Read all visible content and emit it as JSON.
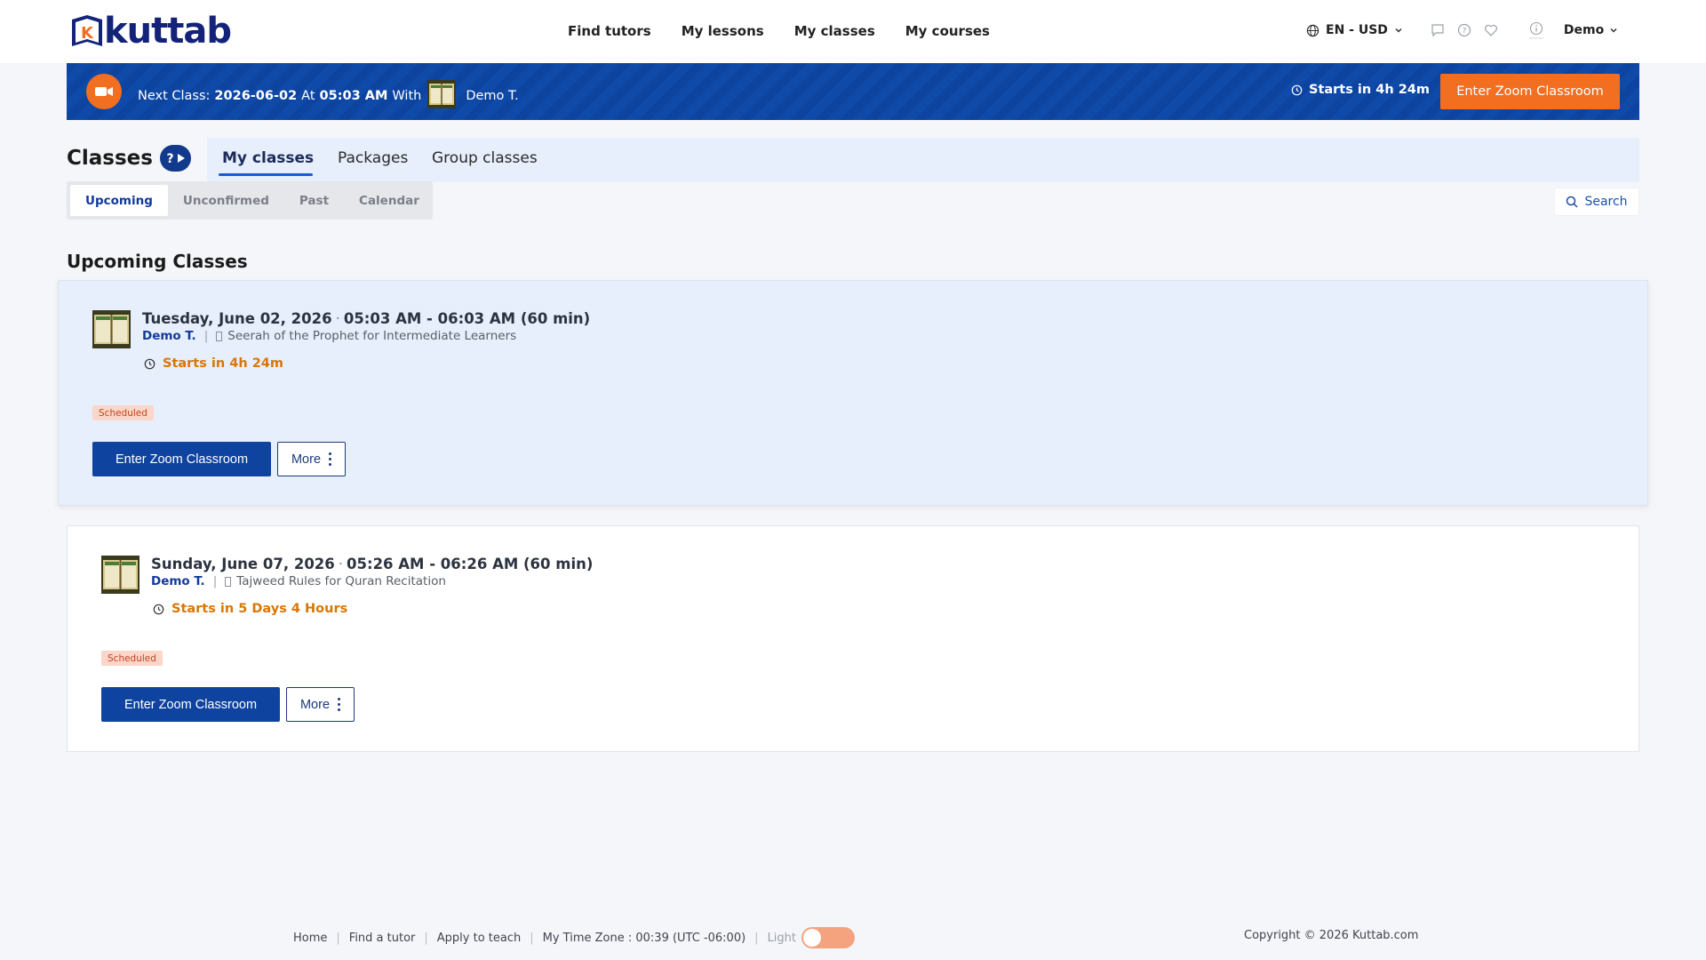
{
  "header": {
    "logo_text": "kuttab",
    "nav": [
      "Find tutors",
      "My lessons",
      "My classes",
      "My courses"
    ],
    "language_currency": "EN - USD",
    "user_name": "Demo",
    "icons": [
      "chat-icon",
      "help-circle-icon",
      "heart-icon",
      "info-icon"
    ]
  },
  "banner": {
    "prefix": "Next Class:",
    "date": "2026-06-02",
    "at": "At",
    "time": "05:03 AM",
    "with": "With",
    "teacher": "Demo T.",
    "starts": "Starts in 4h 24m",
    "button": "Enter Zoom Classroom"
  },
  "page": {
    "title": "Classes",
    "tabs": [
      "My classes",
      "Packages",
      "Group classes"
    ],
    "subtabs": [
      "Upcoming",
      "Unconfirmed",
      "Past",
      "Calendar"
    ],
    "search_label": "Search",
    "section_title": "Upcoming Classes"
  },
  "classes": [
    {
      "date": "Tuesday, June 02, 2026",
      "time": "05:03 AM - 06:03 AM (60 min)",
      "teacher": "Demo T.",
      "course": "Seerah of the Prophet for Intermediate Learners",
      "starts": "Starts in 4h 24m",
      "status": "Scheduled",
      "enter_button": "Enter Zoom Classroom",
      "more_button": "More"
    },
    {
      "date": "Sunday, June 07, 2026",
      "time": "05:26 AM - 06:26 AM (60 min)",
      "teacher": "Demo T.",
      "course": "Tajweed Rules for Quran Recitation",
      "starts": "Starts in 5 Days 4 Hours",
      "status": "Scheduled",
      "enter_button": "Enter Zoom Classroom",
      "more_button": "More"
    }
  ],
  "footer": {
    "links": [
      "Home",
      "Find a tutor",
      "Apply to teach"
    ],
    "timezone": "My Time Zone : 00:39 (UTC -06:00)",
    "theme_label": "Light",
    "copyright": "Copyright © 2026 Kuttab.com"
  },
  "colors": {
    "brand_blue": "#0e43a0",
    "accent_orange": "#f26f22",
    "warning_text": "#d97706"
  }
}
